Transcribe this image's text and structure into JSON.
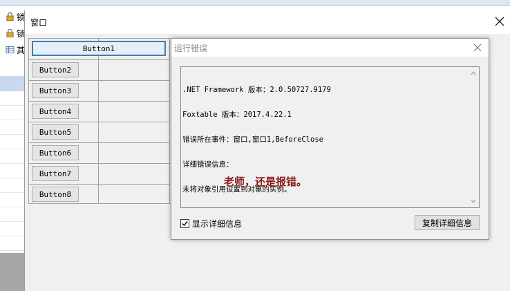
{
  "background": {
    "rows": [
      {
        "label": "锁",
        "icon": "lock-icon"
      },
      {
        "label": "锁",
        "icon": "lock-icon"
      },
      {
        "label": "其",
        "icon": "table-icon"
      }
    ]
  },
  "window": {
    "title": "窗口",
    "close_icon": "close-icon"
  },
  "buttons": [
    {
      "label": "Button1",
      "primary": true
    },
    {
      "label": "Button2"
    },
    {
      "label": "Button3"
    },
    {
      "label": "Button4"
    },
    {
      "label": "Button5"
    },
    {
      "label": "Button6"
    },
    {
      "label": "Button7"
    },
    {
      "label": "Button8"
    }
  ],
  "error_dialog": {
    "title": "运行错误",
    "lines": [
      ".NET Framework 版本：2.0.50727.9179",
      "Foxtable 版本：2017.4.22.1",
      "错误所在事件：窗口,窗口1,BeforeClose",
      "详细错误信息：",
      "未将对象引用设置到对象的实例。"
    ],
    "overlay_note": "老师，还是报错。",
    "overlay_color": "#8b1a1a",
    "show_details_label": "显示详细信息",
    "show_details_checked": true,
    "copy_button_label": "复制详细信息"
  }
}
